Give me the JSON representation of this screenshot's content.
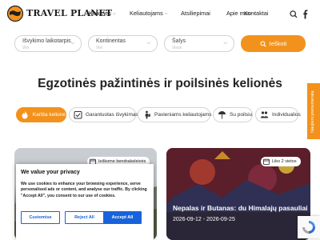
{
  "header": {
    "logo_text": "TRAVEL PLANET",
    "nav": [
      {
        "label": "Kelionės",
        "has_dropdown": true
      },
      {
        "label": "Keliautojams",
        "has_dropdown": true
      },
      {
        "label": "Atsiliepimai",
        "has_dropdown": false
      },
      {
        "label": "Apie mus",
        "has_dropdown": true
      },
      {
        "label": "Kontaktai",
        "has_dropdown": false
      }
    ],
    "icons": [
      "search-icon",
      "facebook-icon"
    ]
  },
  "search": {
    "fields": [
      {
        "label": "Išvykimo laikotarpis",
        "sub": "Visi"
      },
      {
        "label": "Kontinentas",
        "sub": "Visi"
      },
      {
        "label": "Šalys",
        "sub": "Visos"
      }
    ],
    "button_label": "Ieškoti"
  },
  "page_title": "Egzotinės pažintinės ir poilsinės kelionės",
  "pills": [
    {
      "label": "Karšta kelionė",
      "active": true,
      "icon": "fire-icon"
    },
    {
      "label": "Garantuotas išvykimas",
      "active": false,
      "icon": "guarantee-icon"
    },
    {
      "label": "Pavieniams keliautojams",
      "active": false,
      "icon": "solo-traveler-icon"
    },
    {
      "label": "Su poilsiu",
      "active": false,
      "icon": "beach-umbrella-icon"
    },
    {
      "label": "Individualios",
      "active": false,
      "icon": "group-icon"
    }
  ],
  "feedback_tab": "Naujieni prenumerata",
  "cards": [
    {
      "badge": "Ieškome bendrakeleivės",
      "title": "",
      "date": ""
    },
    {
      "badge": "Liko 2 vietos",
      "title": "Nepalas ir Butanas: du Himalajų pasauliai",
      "date": "2026-09-12 - 2026-09-25"
    }
  ],
  "cookie": {
    "title": "We value your privacy",
    "body": "We use cookies to enhance your browsing experience, serve personalised ads or content, and analyse our traffic. By clicking \"Accept All\", you consent to our use of cookies.",
    "customise_label": "Customise",
    "reject_label": "Reject All",
    "accept_label": "Accept All"
  },
  "colors": {
    "accent": "#f2921d",
    "cookie_blue": "#1863dc"
  }
}
